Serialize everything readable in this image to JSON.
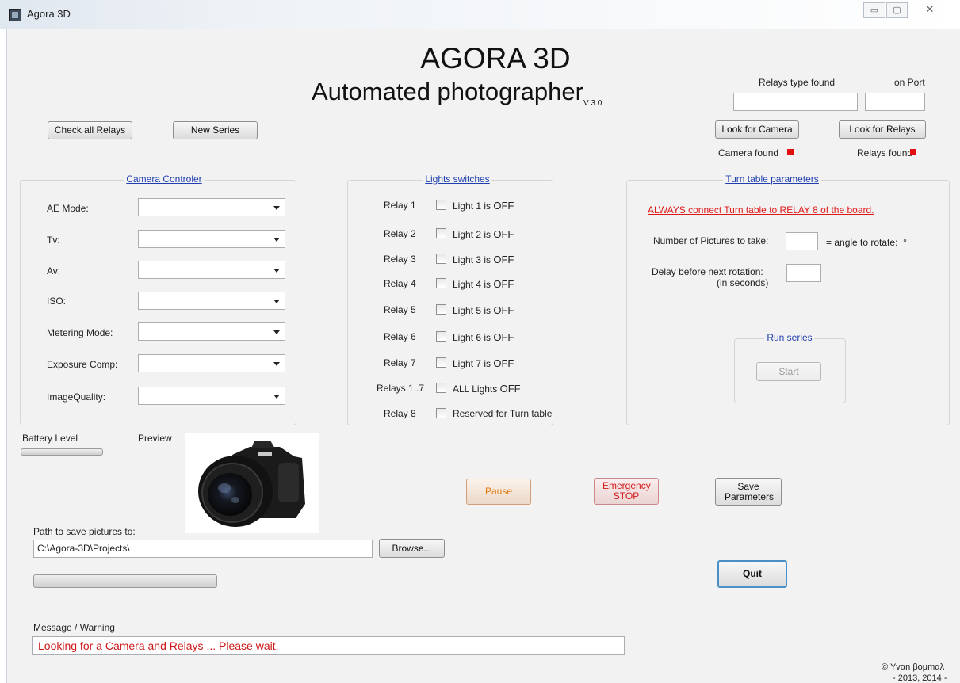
{
  "window": {
    "title": "Agora 3D",
    "controls": {
      "minimize": "▭",
      "maximize": "▢",
      "close": "✕"
    }
  },
  "header": {
    "title": "AGORA 3D",
    "subtitle": "Automated photographer",
    "version": "V 3.0"
  },
  "top_buttons": {
    "check_all_relays": "Check all Relays",
    "new_series": "New Series"
  },
  "relays_panel": {
    "relays_type_label": "Relays type found",
    "on_port_label": "on Port",
    "relays_type_value": "",
    "port_value": "",
    "look_for_camera": "Look for Camera",
    "look_for_relays": "Look for Relays",
    "camera_found": "Camera found",
    "relays_found": "Relays found",
    "status_color": "#e01010"
  },
  "camera_controller": {
    "title": "Camera Controler",
    "fields": [
      {
        "label": "AE Mode:",
        "value": ""
      },
      {
        "label": "Tv:",
        "value": ""
      },
      {
        "label": "Av:",
        "value": ""
      },
      {
        "label": "ISO:",
        "value": ""
      },
      {
        "label": "Metering Mode:",
        "value": ""
      },
      {
        "label": "Exposure Comp:",
        "value": ""
      },
      {
        "label": "ImageQuality:",
        "value": ""
      }
    ]
  },
  "lights": {
    "title": "Lights switches",
    "rows": [
      {
        "relay": "Relay 1",
        "text": "Light 1 is",
        "state": "OFF",
        "checked": false
      },
      {
        "relay": "Relay 2",
        "text": "Light 2 is",
        "state": "OFF",
        "checked": false
      },
      {
        "relay": "Relay 3",
        "text": "Light 3 is",
        "state": "OFF",
        "checked": false
      },
      {
        "relay": "Relay 4",
        "text": "Light 4 is",
        "state": "OFF",
        "checked": false
      },
      {
        "relay": "Relay 5",
        "text": "Light 5 is",
        "state": "OFF",
        "checked": false
      },
      {
        "relay": "Relay 6",
        "text": "Light 6 is",
        "state": "OFF",
        "checked": false
      },
      {
        "relay": "Relay 7",
        "text": "Light 7 is",
        "state": "OFF",
        "checked": false
      },
      {
        "relay": "Relays 1..7",
        "text": "ALL Lights",
        "state": "OFF",
        "checked": false
      },
      {
        "relay": "Relay 8",
        "text": "Reserved for Turn table",
        "state": "",
        "checked": false
      }
    ]
  },
  "turntable": {
    "title": "Turn table parameters",
    "warning": "ALWAYS connect Turn table to RELAY 8 of the board.",
    "num_pictures_label": "Number of Pictures to take:",
    "num_pictures_value": "",
    "angle_label": "= angle to rotate:",
    "angle_unit": "°",
    "delay_label": "Delay before next rotation:",
    "delay_sub": "(in seconds)",
    "delay_value": "",
    "run_series_title": "Run series",
    "start": "Start"
  },
  "battery": {
    "label": "Battery Level",
    "level": 0
  },
  "preview": {
    "label": "Preview"
  },
  "actions": {
    "pause": "Pause",
    "emergency_stop": "Emergency STOP",
    "save_parameters": "Save Parameters",
    "quit": "Quit",
    "pause_color": "#e07a10",
    "stop_color": "#d01818"
  },
  "path": {
    "label": "Path to save pictures to:",
    "value": "C:\\Agora-3D\\Projects\\",
    "browse": "Browse..."
  },
  "progress": {
    "level": 0
  },
  "message": {
    "label": "Message / Warning",
    "text": "Looking for a Camera and Relays ... Please wait.",
    "color": "#d01818"
  },
  "footer": {
    "author": "© Υvαn βoμmαλ",
    "years": "- 2013, 2014 -"
  }
}
